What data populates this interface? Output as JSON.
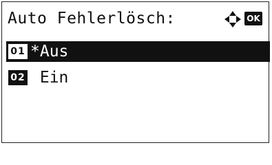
{
  "screen": {
    "title": "Auto Fehlerlösch:",
    "nav_icon": "four-way-arrow-icon",
    "ok_label": "OK"
  },
  "options": [
    {
      "number": "01",
      "label": "*Aus",
      "selected": true
    },
    {
      "number": "02",
      "label": " Ein",
      "selected": false
    }
  ]
}
